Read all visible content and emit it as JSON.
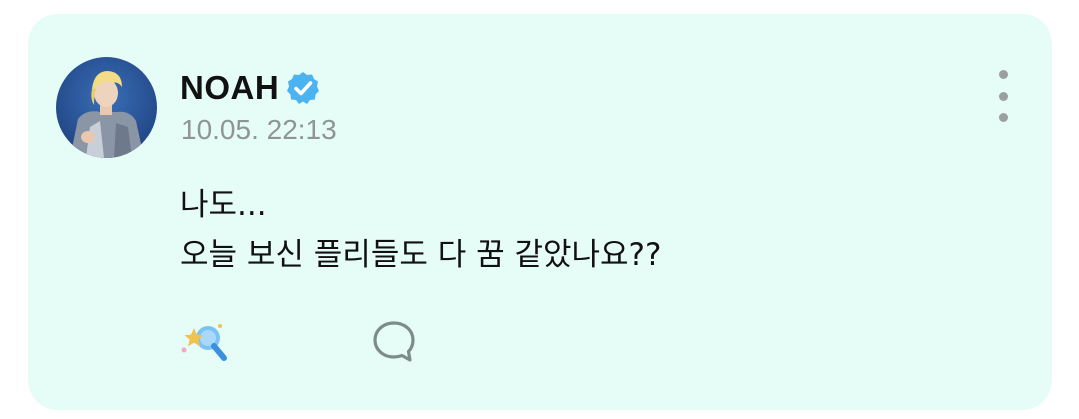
{
  "post": {
    "author": "NOAH",
    "timestamp": "10.05. 22:13",
    "lines": [
      "나도...",
      "오늘 보신 플리들도 다 꿈 같았나요??"
    ]
  },
  "icons": {
    "avatar": "profile-photo",
    "verified": "verified-badge-icon",
    "more": "more-vertical-icon",
    "reaction": "sparkle-reaction-icon",
    "comment": "speech-bubble-icon"
  },
  "colors": {
    "card_background": "#e6fcf7",
    "verified_badge": "#4bb3f0",
    "timestamp": "#8f9594",
    "icon_gray": "#9aa09f",
    "comment_icon": "#7d8b89",
    "reaction_blue": "#3a8fe0",
    "reaction_star": "#f2c14e"
  }
}
